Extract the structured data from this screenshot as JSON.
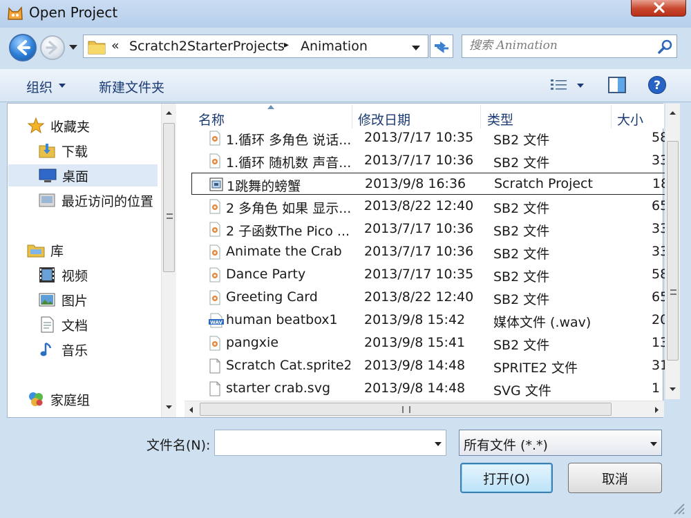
{
  "window": {
    "title": "Open Project"
  },
  "address": {
    "chevron": "«",
    "segment_root": "Scratch2StarterProjects",
    "segment_current": "Animation",
    "separator": "▸"
  },
  "search": {
    "placeholder": "搜索 Animation"
  },
  "toolbar": {
    "organize": "组织",
    "new_folder": "新建文件夹"
  },
  "nav": {
    "items": [
      {
        "label": "收藏夹",
        "icon": "star-icon"
      },
      {
        "label": "下载",
        "icon": "download-folder-icon"
      },
      {
        "label": "桌面",
        "icon": "desktop-icon",
        "selected": true
      },
      {
        "label": "最近访问的位置",
        "icon": "recent-places-icon"
      },
      {
        "label": "库",
        "icon": "library-icon"
      },
      {
        "label": "视频",
        "icon": "video-icon"
      },
      {
        "label": "图片",
        "icon": "picture-icon"
      },
      {
        "label": "文档",
        "icon": "document-icon"
      },
      {
        "label": "音乐",
        "icon": "music-icon"
      },
      {
        "label": "家庭组",
        "icon": "homegroup-icon"
      }
    ]
  },
  "columns": {
    "name": "名称",
    "date": "修改日期",
    "type": "类型",
    "size": "大小"
  },
  "files": [
    {
      "name": "1.循环 多角色 说话...",
      "date": "2013/7/17 10:35",
      "type": "SB2 文件",
      "size": "58",
      "icon": "sb2-file-icon"
    },
    {
      "name": "1.循环 随机数 声音...",
      "date": "2013/7/17 10:36",
      "type": "SB2 文件",
      "size": "33",
      "icon": "sb2-file-icon"
    },
    {
      "name": "1跳舞的螃蟹",
      "date": "2013/9/8 16:36",
      "type": "Scratch Project",
      "size": "18",
      "icon": "scratch-project-icon",
      "focused": true
    },
    {
      "name": "2 多角色 如果 显示...",
      "date": "2013/8/22 12:40",
      "type": "SB2 文件",
      "size": "65",
      "icon": "sb2-file-icon"
    },
    {
      "name": "2 子函数The Pico ...",
      "date": "2013/7/17 10:36",
      "type": "SB2 文件",
      "size": "33",
      "icon": "sb2-file-icon"
    },
    {
      "name": "Animate the Crab",
      "date": "2013/7/17 10:36",
      "type": "SB2 文件",
      "size": "33",
      "icon": "sb2-file-icon"
    },
    {
      "name": "Dance Party",
      "date": "2013/7/17 10:35",
      "type": "SB2 文件",
      "size": "58",
      "icon": "sb2-file-icon"
    },
    {
      "name": "Greeting Card",
      "date": "2013/8/22 12:40",
      "type": "SB2 文件",
      "size": "65",
      "icon": "sb2-file-icon"
    },
    {
      "name": "human beatbox1",
      "date": "2013/9/8 15:42",
      "type": "媒体文件 (.wav)",
      "size": "20",
      "icon": "wav-file-icon"
    },
    {
      "name": "pangxie",
      "date": "2013/9/8 15:41",
      "type": "SB2 文件",
      "size": "13",
      "icon": "sb2-file-icon"
    },
    {
      "name": "Scratch Cat.sprite2",
      "date": "2013/9/8 14:48",
      "type": "SPRITE2 文件",
      "size": "31",
      "icon": "blank-file-icon"
    },
    {
      "name": "starter crab.svg",
      "date": "2013/9/8 14:48",
      "type": "SVG 文件",
      "size": "1",
      "icon": "blank-file-icon"
    }
  ],
  "scroll_grip": "III",
  "footer": {
    "filename_label": "文件名(N):",
    "filename_value": "",
    "filetype_value": "所有文件 (*.*)",
    "open_label": "打开(O)",
    "cancel_label": "取消"
  },
  "colors": {
    "accent": "#3c7fb1",
    "close": "#c8452c",
    "link": "#1b3a73"
  }
}
